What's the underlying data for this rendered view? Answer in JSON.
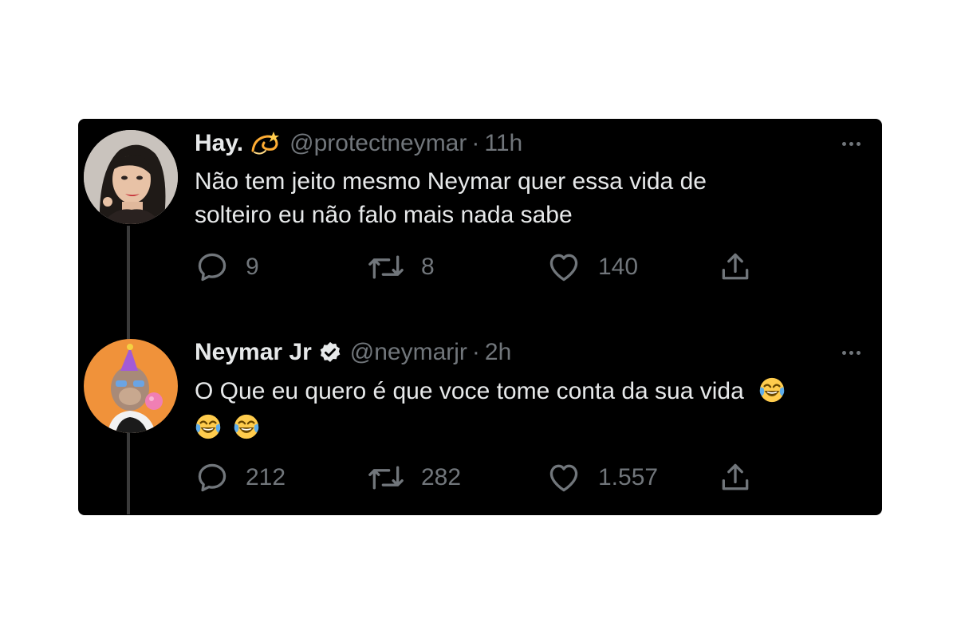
{
  "tweets": [
    {
      "display_name": "Hay.",
      "name_emoji": "dizzy-emoji",
      "handle": "@protectneymar",
      "separator": "·",
      "time": "11h",
      "text_line1": "Não tem jeito mesmo Neymar quer essa vida de",
      "text_line2": "solteiro eu não falo mais nada sabe",
      "replies": "9",
      "retweets": "8",
      "likes": "140"
    },
    {
      "display_name": "Neymar Jr",
      "verified": true,
      "handle": "@neymarjr",
      "separator": "·",
      "time": "2h",
      "text_line1": "O Que eu quero é que voce tome conta da sua vida",
      "emojis": [
        "laughing-tears-emoji",
        "laughing-tears-emoji",
        "laughing-tears-emoji"
      ],
      "replies": "212",
      "retweets": "282",
      "likes": "1.557"
    }
  ],
  "colors": {
    "background": "#000000",
    "primary_text": "#e7e9ea",
    "secondary_text": "#71767b",
    "thread_line": "#3a3a3a"
  }
}
